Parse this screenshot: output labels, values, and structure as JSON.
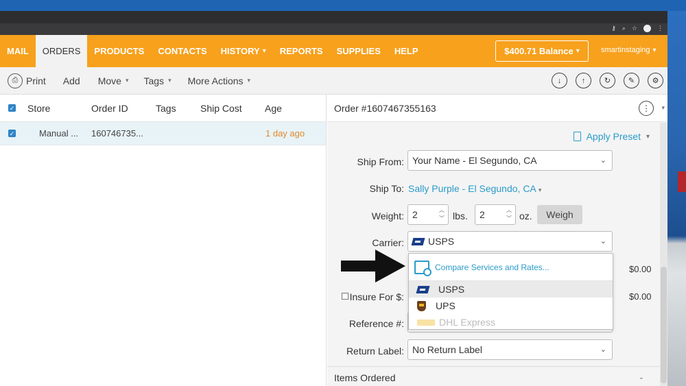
{
  "nav": {
    "items": [
      {
        "label": "MAIL",
        "caret": false,
        "active": false
      },
      {
        "label": "ORDERS",
        "caret": false,
        "active": true
      },
      {
        "label": "PRODUCTS",
        "caret": false,
        "active": false
      },
      {
        "label": "CONTACTS",
        "caret": false,
        "active": false
      },
      {
        "label": "HISTORY",
        "caret": true,
        "active": false
      },
      {
        "label": "REPORTS",
        "caret": false,
        "active": false
      },
      {
        "label": "SUPPLIES",
        "caret": false,
        "active": false
      },
      {
        "label": "HELP",
        "caret": false,
        "active": false
      }
    ],
    "balance": "$400.71 Balance",
    "account": "smartinstaging"
  },
  "toolbar": {
    "print": "Print",
    "add": "Add",
    "move": "Move",
    "tags": "Tags",
    "more_actions": "More Actions",
    "right_icons": [
      "download-icon",
      "upload-icon",
      "refresh-icon",
      "edit-icon",
      "settings-icon"
    ]
  },
  "grid": {
    "headers": {
      "store": "Store",
      "order_id": "Order ID",
      "tags": "Tags",
      "ship_cost": "Ship Cost",
      "age": "Age"
    },
    "rows": [
      {
        "store": "Manual ...",
        "order_id": "160746735...",
        "tags": "",
        "ship_cost": "",
        "age": "1 day ago"
      }
    ]
  },
  "order": {
    "title": "Order #1607467355163",
    "apply_preset": "Apply Preset",
    "ship_from_label": "Ship From:",
    "ship_from_value": "Your Name - El Segundo, CA",
    "ship_to_label": "Ship To:",
    "ship_to_value": "Sally Purple - El Segundo, CA",
    "weight_label": "Weight:",
    "weight_lbs": "2",
    "lbs_unit": "lbs.",
    "weight_oz": "2",
    "oz_unit": "oz.",
    "weigh_button": "Weigh",
    "carrier_label": "Carrier:",
    "carrier_value": "USPS",
    "service_price": "$0.00",
    "insure_label": "Insure For $:",
    "insure_price": "$0.00",
    "reference_label": "Reference #:",
    "return_label_label": "Return Label:",
    "return_label_value": "No Return Label",
    "items_ordered": "Items Ordered"
  },
  "carrier_dropdown": {
    "compare": "Compare Services and Rates...",
    "options": [
      {
        "label": "USPS",
        "logo": "usps-logo",
        "highlighted": true,
        "disabled": false
      },
      {
        "label": "UPS",
        "logo": "ups-logo",
        "highlighted": false,
        "disabled": false
      },
      {
        "label": "DHL Express",
        "logo": "dhl-logo",
        "highlighted": false,
        "disabled": true
      }
    ]
  },
  "colors": {
    "nav_orange": "#f7a11d",
    "link_blue": "#2a9bc9",
    "age_orange": "#e08a2b",
    "usps_blue": "#1a3f8a"
  }
}
